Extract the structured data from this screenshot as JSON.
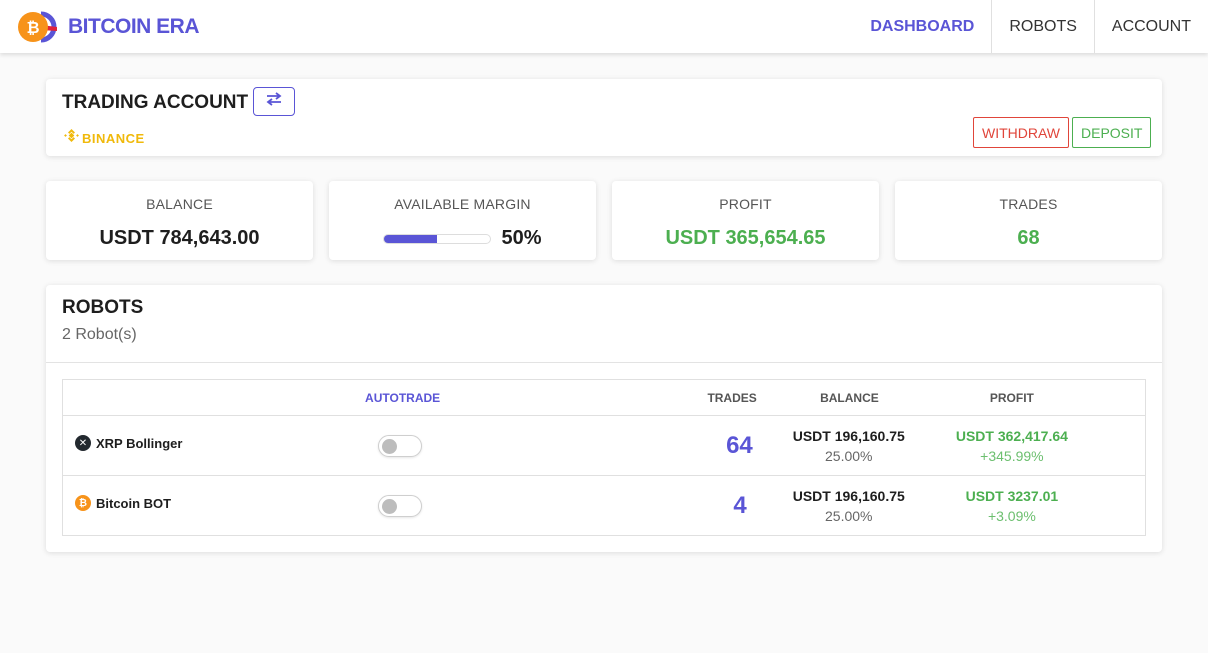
{
  "brand": {
    "name": "BITCOIN ERA",
    "logo_icon": "bitcoin-era-logo"
  },
  "nav": {
    "items": [
      {
        "label": "DASHBOARD",
        "active": true
      },
      {
        "label": "ROBOTS",
        "active": false
      },
      {
        "label": "ACCOUNT",
        "active": false
      }
    ]
  },
  "trading_account": {
    "title": "TRADING ACCOUNT",
    "swap_icon": "swap-arrows-icon",
    "exchange": "BINANCE",
    "withdraw_label": "WITHDRAW",
    "deposit_label": "DEPOSIT"
  },
  "stats": {
    "balance": {
      "label": "BALANCE",
      "value": "USDT 784,643.00"
    },
    "available_margin": {
      "label": "AVAILABLE MARGIN",
      "value": "50%",
      "percent": 50
    },
    "profit": {
      "label": "PROFIT",
      "value": "USDT 365,654.65"
    },
    "trades": {
      "label": "TRADES",
      "value": "68"
    }
  },
  "robots": {
    "title": "ROBOTS",
    "subtitle": "2 Robot(s)",
    "columns": [
      "",
      "AUTOTRADE",
      "TRADES",
      "BALANCE",
      "PROFIT"
    ],
    "rows": [
      {
        "name": "XRP Bollinger",
        "icon": "xrp-icon",
        "autotrade": false,
        "trades": "64",
        "balance": "USDT 196,160.75",
        "balance_pct": "25.00%",
        "profit": "USDT 362,417.64",
        "profit_pct": "+345.99%"
      },
      {
        "name": "Bitcoin BOT",
        "icon": "bitcoin-icon",
        "autotrade": false,
        "trades": "4",
        "balance": "USDT 196,160.75",
        "balance_pct": "25.00%",
        "profit": "USDT 3237.01",
        "profit_pct": "+3.09%"
      }
    ]
  },
  "colors": {
    "accent": "#5a55d6",
    "positive": "#4caf50",
    "negative": "#e0453a",
    "binance": "#f0b90b"
  }
}
